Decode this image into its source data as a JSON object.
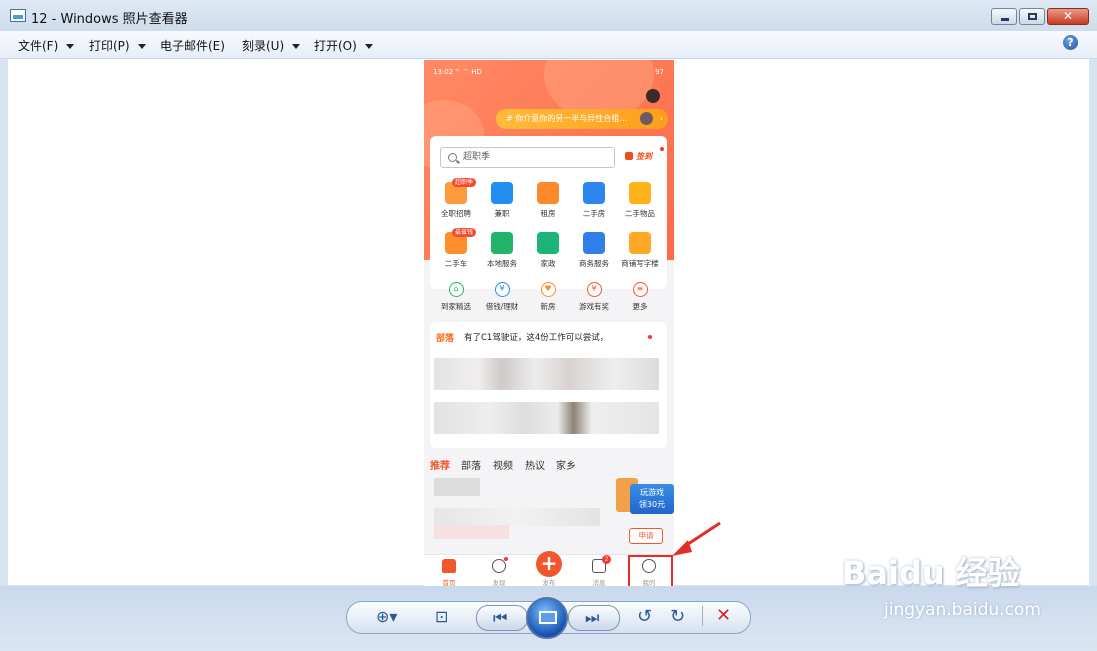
{
  "window": {
    "title": "12 - Windows 照片查看器"
  },
  "menu": [
    {
      "label": "文件(F)",
      "has_arrow": true
    },
    {
      "label": "打印(P)",
      "has_arrow": true
    },
    {
      "label": "电子邮件(E)",
      "has_arrow": false
    },
    {
      "label": "刻录(U)",
      "has_arrow": true
    },
    {
      "label": "打开(O)",
      "has_arrow": true
    }
  ],
  "phone": {
    "status_time": "13:02",
    "status_extra": "ᵀᵗ ⌔ HD",
    "battery": "97",
    "banner": "# 你介意你的另一半与异性合租…",
    "search_placeholder": "超职季",
    "sign_in": "签到",
    "grid_row1": [
      {
        "label": "全职招聘",
        "badge": "超职季",
        "color": "#ff9a3a"
      },
      {
        "label": "兼职",
        "badge": "",
        "color": "#1f8ff2"
      },
      {
        "label": "租房",
        "badge": "",
        "color": "#ff8a2b"
      },
      {
        "label": "二手房",
        "badge": "",
        "color": "#2d86ee"
      },
      {
        "label": "二手物品",
        "badge": "",
        "color": "#ffb21a"
      }
    ],
    "grid_row2": [
      {
        "label": "二手车",
        "badge": "最省钱",
        "color": "#ff8f2a"
      },
      {
        "label": "本地服务",
        "badge": "",
        "color": "#23b46b"
      },
      {
        "label": "家政",
        "badge": "",
        "color": "#1cb478"
      },
      {
        "label": "商务服务",
        "badge": "",
        "color": "#2f7fe8"
      },
      {
        "label": "商铺写字楼",
        "badge": "",
        "color": "#ffa825"
      }
    ],
    "grid_row3": [
      {
        "label": "到家精选",
        "glyph": "⌂",
        "color": "#2db06a"
      },
      {
        "label": "借钱/理财",
        "glyph": "¥",
        "color": "#2f86ee"
      },
      {
        "label": "新房",
        "glyph": "♥",
        "color": "#ff8a2b"
      },
      {
        "label": "游戏有奖",
        "glyph": "¥",
        "color": "#f2562c"
      },
      {
        "label": "更多",
        "glyph": "≡",
        "color": "#f2562c"
      }
    ],
    "feed_tag": "部落",
    "feed_text": "有了C1驾驶证，这4份工作可以尝试，",
    "tabs": [
      "推荐",
      "部落",
      "视频",
      "热议",
      "家乡"
    ],
    "game_promo": {
      "line1": "玩游戏",
      "line2": "领30元"
    },
    "apply": "申请",
    "bottom_nav": [
      {
        "label": "首页",
        "active": true
      },
      {
        "label": "发现",
        "active": false
      },
      {
        "label": "发布",
        "active": false
      },
      {
        "label": "消息",
        "active": false,
        "badge": "2"
      },
      {
        "label": "我的",
        "active": false
      }
    ]
  },
  "watermark": {
    "brand": "Baidu 经验",
    "url": "jingyan.baidu.com"
  },
  "colors": {
    "accent": "#f2562c",
    "highlight_box": "#e52d27"
  }
}
